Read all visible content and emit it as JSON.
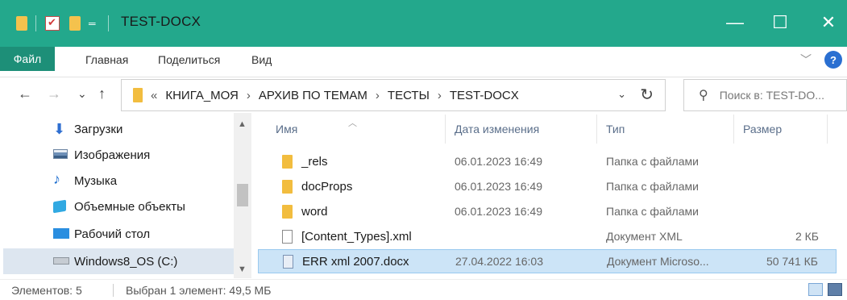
{
  "window": {
    "title": "TEST-DOCX",
    "controls": [
      "minimize",
      "maximize",
      "close"
    ],
    "accent": "#23a88c"
  },
  "ribbon": {
    "tabs": [
      "Файл",
      "Главная",
      "Поделиться",
      "Вид"
    ]
  },
  "nav": {
    "back": "←",
    "forward": "→",
    "recent": "⌄",
    "up": "↑"
  },
  "address": {
    "overflow": "«",
    "crumbs": [
      "КНИГА_МОЯ",
      "АРХИВ ПО ТЕМАМ",
      "ТЕСТЫ",
      "TEST-DOCX"
    ],
    "separator": "›"
  },
  "search": {
    "placeholder": "Поиск в: TEST-DO..."
  },
  "sidebar": {
    "items": [
      {
        "label": "Загрузки",
        "icon": "download-icon"
      },
      {
        "label": "Изображения",
        "icon": "pictures-icon"
      },
      {
        "label": "Музыка",
        "icon": "music-icon"
      },
      {
        "label": "Объемные объекты",
        "icon": "3d-objects-icon"
      },
      {
        "label": "Рабочий стол",
        "icon": "desktop-icon"
      },
      {
        "label": "Windows8_OS (C:)",
        "icon": "drive-icon",
        "selected": true
      }
    ]
  },
  "files": {
    "columns": {
      "name": "Имя",
      "date": "Дата изменения",
      "type": "Тип",
      "size": "Размер"
    },
    "rows": [
      {
        "name": "_rels",
        "date": "06.01.2023 16:49",
        "type": "Папка с файлами",
        "size": "",
        "icon": "folder-icon"
      },
      {
        "name": "docProps",
        "date": "06.01.2023 16:49",
        "type": "Папка с файлами",
        "size": "",
        "icon": "folder-icon"
      },
      {
        "name": "word",
        "date": "06.01.2023 16:49",
        "type": "Папка с файлами",
        "size": "",
        "icon": "folder-icon"
      },
      {
        "name": "[Content_Types].xml",
        "date": "",
        "type": "Документ XML",
        "size": "2 КБ",
        "icon": "xml-file-icon"
      },
      {
        "name": "ERR xml 2007.docx",
        "date": "27.04.2022 16:03",
        "type": "Документ Microso...",
        "size": "50 741 КБ",
        "icon": "docx-file-icon",
        "selected": true
      }
    ]
  },
  "status": {
    "count": "Элементов: 5",
    "selection": "Выбран 1 элемент: 49,5 МБ"
  }
}
